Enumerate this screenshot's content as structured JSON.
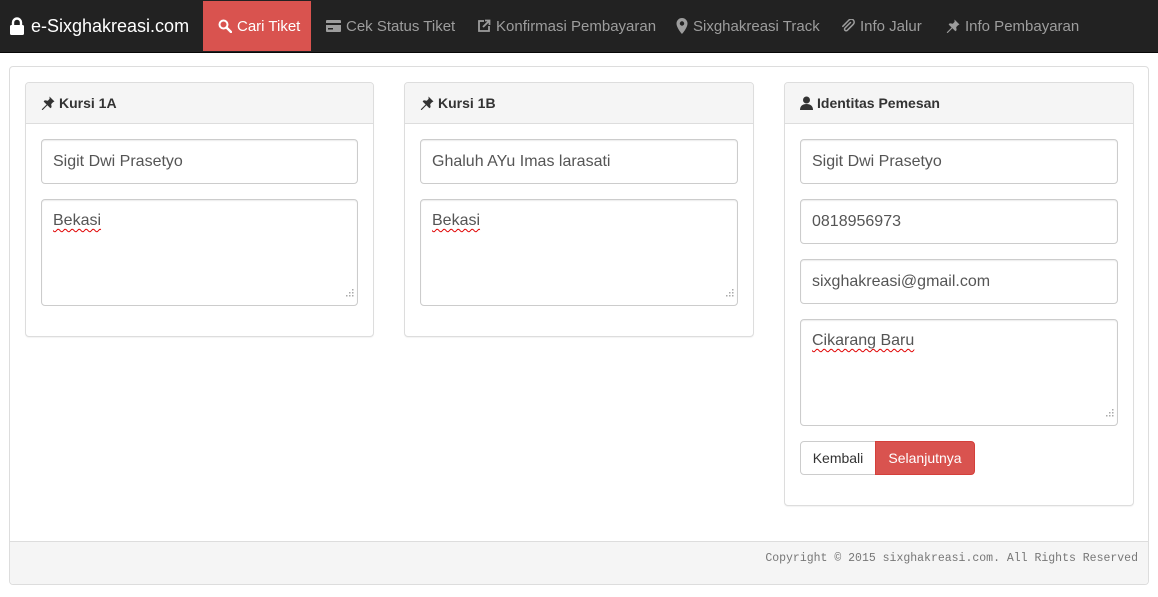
{
  "navbar": {
    "brand": "e-Sixghakreasi.com",
    "brand_icon": "lock-icon",
    "items": [
      {
        "label": "Cari Tiket",
        "icon": "search-icon",
        "active": true
      },
      {
        "label": "Cek Status Tiket",
        "icon": "credit-card-icon",
        "active": false
      },
      {
        "label": "Konfirmasi Pembayaran",
        "icon": "share-icon",
        "active": false
      },
      {
        "label": "Sixghakreasi Track",
        "icon": "map-marker-icon",
        "active": false
      },
      {
        "label": "Info Jalur",
        "icon": "paperclip-icon",
        "active": false
      },
      {
        "label": "Info Pembayaran",
        "icon": "pushpin-icon",
        "active": false
      }
    ]
  },
  "seats": [
    {
      "title": "Kursi 1A",
      "name": "Sigit Dwi Prasetyo",
      "address": "Bekasi"
    },
    {
      "title": "Kursi 1B",
      "name": "Ghaluh AYu Imas larasati",
      "address": "Bekasi"
    }
  ],
  "orderer": {
    "title": "Identitas Pemesan",
    "name": "Sigit Dwi Prasetyo",
    "phone": "0818956973",
    "email": "sixghakreasi@gmail.com",
    "address": "Cikarang Baru"
  },
  "buttons": {
    "back": "Kembali",
    "next": "Selanjutnya"
  },
  "footer": {
    "copyright": "Copyright © 2015 sixghakreasi.com. All Rights Reserved"
  },
  "colors": {
    "navbar": "#222222",
    "active_nav": "#d9534f",
    "danger_button": "#d9534f"
  }
}
